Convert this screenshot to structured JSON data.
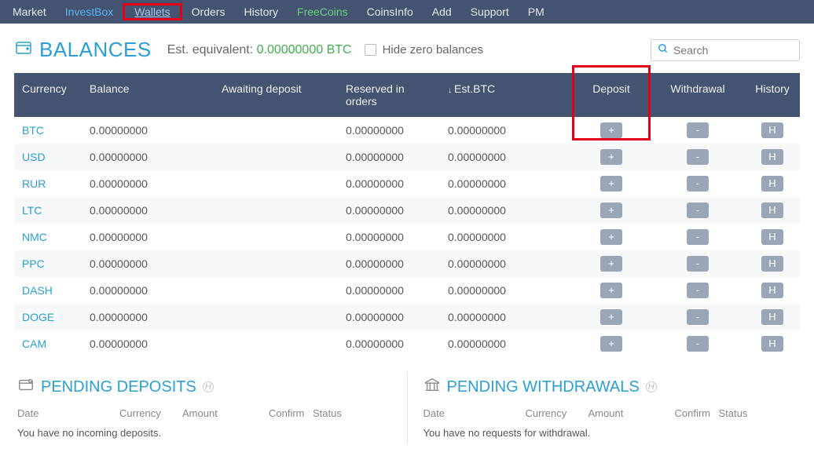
{
  "nav": {
    "items": [
      {
        "label": "Market",
        "style": "normal"
      },
      {
        "label": "InvestBox",
        "style": "blue"
      },
      {
        "label": "Wallets",
        "style": "active",
        "highlighted": true
      },
      {
        "label": "Orders",
        "style": "normal"
      },
      {
        "label": "History",
        "style": "normal"
      },
      {
        "label": "FreeCoins",
        "style": "green"
      },
      {
        "label": "CoinsInfo",
        "style": "normal"
      },
      {
        "label": "Add",
        "style": "normal"
      },
      {
        "label": "Support",
        "style": "normal"
      },
      {
        "label": "PM",
        "style": "normal"
      }
    ]
  },
  "balances_title": "BALANCES",
  "est_label": "Est. equivalent:",
  "est_value": "0.00000000 BTC",
  "hide_zero_label": "Hide zero balances",
  "search_placeholder": "Search",
  "table": {
    "headers": {
      "currency": "Currency",
      "balance": "Balance",
      "awaiting": "Awaiting deposit",
      "reserved": "Reserved in orders",
      "estbtc": "Est.BTC",
      "deposit": "Deposit",
      "withdrawal": "Withdrawal",
      "history": "History"
    },
    "rows": [
      {
        "cur": "BTC",
        "bal": "0.00000000",
        "await": "",
        "res": "0.00000000",
        "est": "0.00000000"
      },
      {
        "cur": "USD",
        "bal": "0.00000000",
        "await": "",
        "res": "0.00000000",
        "est": "0.00000000"
      },
      {
        "cur": "RUR",
        "bal": "0.00000000",
        "await": "",
        "res": "0.00000000",
        "est": "0.00000000"
      },
      {
        "cur": "LTC",
        "bal": "0.00000000",
        "await": "",
        "res": "0.00000000",
        "est": "0.00000000"
      },
      {
        "cur": "NMC",
        "bal": "0.00000000",
        "await": "",
        "res": "0.00000000",
        "est": "0.00000000"
      },
      {
        "cur": "PPC",
        "bal": "0.00000000",
        "await": "",
        "res": "0.00000000",
        "est": "0.00000000"
      },
      {
        "cur": "DASH",
        "bal": "0.00000000",
        "await": "",
        "res": "0.00000000",
        "est": "0.00000000"
      },
      {
        "cur": "DOGE",
        "bal": "0.00000000",
        "await": "",
        "res": "0.00000000",
        "est": "0.00000000"
      },
      {
        "cur": "CAM",
        "bal": "0.00000000",
        "await": "",
        "res": "0.00000000",
        "est": "0.00000000"
      }
    ],
    "btn_deposit": "+",
    "btn_withdraw": "-",
    "btn_history": "H"
  },
  "pending_deposits": {
    "title": "PENDING DEPOSITS",
    "cols": {
      "date": "Date",
      "currency": "Currency",
      "amount": "Amount",
      "confirm": "Confirm",
      "status": "Status"
    },
    "empty": "You have no incoming deposits."
  },
  "pending_withdrawals": {
    "title": "PENDING WITHDRAWALS",
    "cols": {
      "date": "Date",
      "currency": "Currency",
      "amount": "Amount",
      "confirm": "Confirm",
      "status": "Status"
    },
    "empty": "You have no requests for withdrawal."
  }
}
